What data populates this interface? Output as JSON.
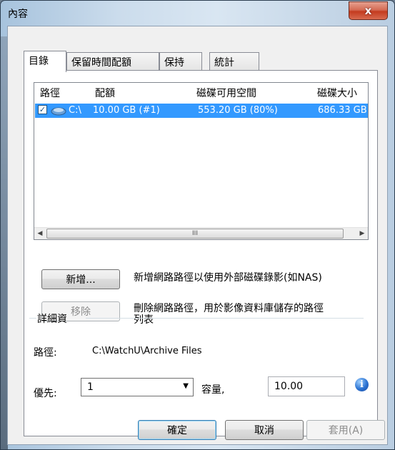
{
  "window": {
    "title": "內容",
    "close_glyph": "x"
  },
  "tabs": [
    {
      "label": "目錄"
    },
    {
      "label": "保留時間配額"
    },
    {
      "label": "保持"
    },
    {
      "label": "統計"
    }
  ],
  "list": {
    "headers": [
      "路徑",
      "配額",
      "磁碟可用空間",
      "磁碟大小"
    ],
    "rows": [
      {
        "checked": true,
        "path": "C:\\",
        "quota": "10.00 GB (#1)",
        "free": "553.20 GB (80%)",
        "size": "686.33 GB"
      }
    ],
    "scroll_grip": "III"
  },
  "actions": {
    "add_label": "新增...",
    "add_desc": "新增網路路徑以使用外部磁碟錄影(如NAS)",
    "remove_label": "移除",
    "remove_desc_line1": "刪除網路路徑，用於影像資料庫儲存的路徑",
    "remove_desc_line2": "列表"
  },
  "details": {
    "section_title": "詳細資",
    "path_label": "路徑:",
    "path_value": "C:\\WatchU\\Archive Files",
    "priority_label": "優先:",
    "priority_value": "1",
    "capacity_label": "容量,",
    "capacity_value": "10.00"
  },
  "footer": {
    "ok": "確定",
    "cancel": "取消",
    "apply": "套用(A)"
  },
  "colors": {
    "selection": "#3399ff",
    "close": "#c33b1f"
  }
}
